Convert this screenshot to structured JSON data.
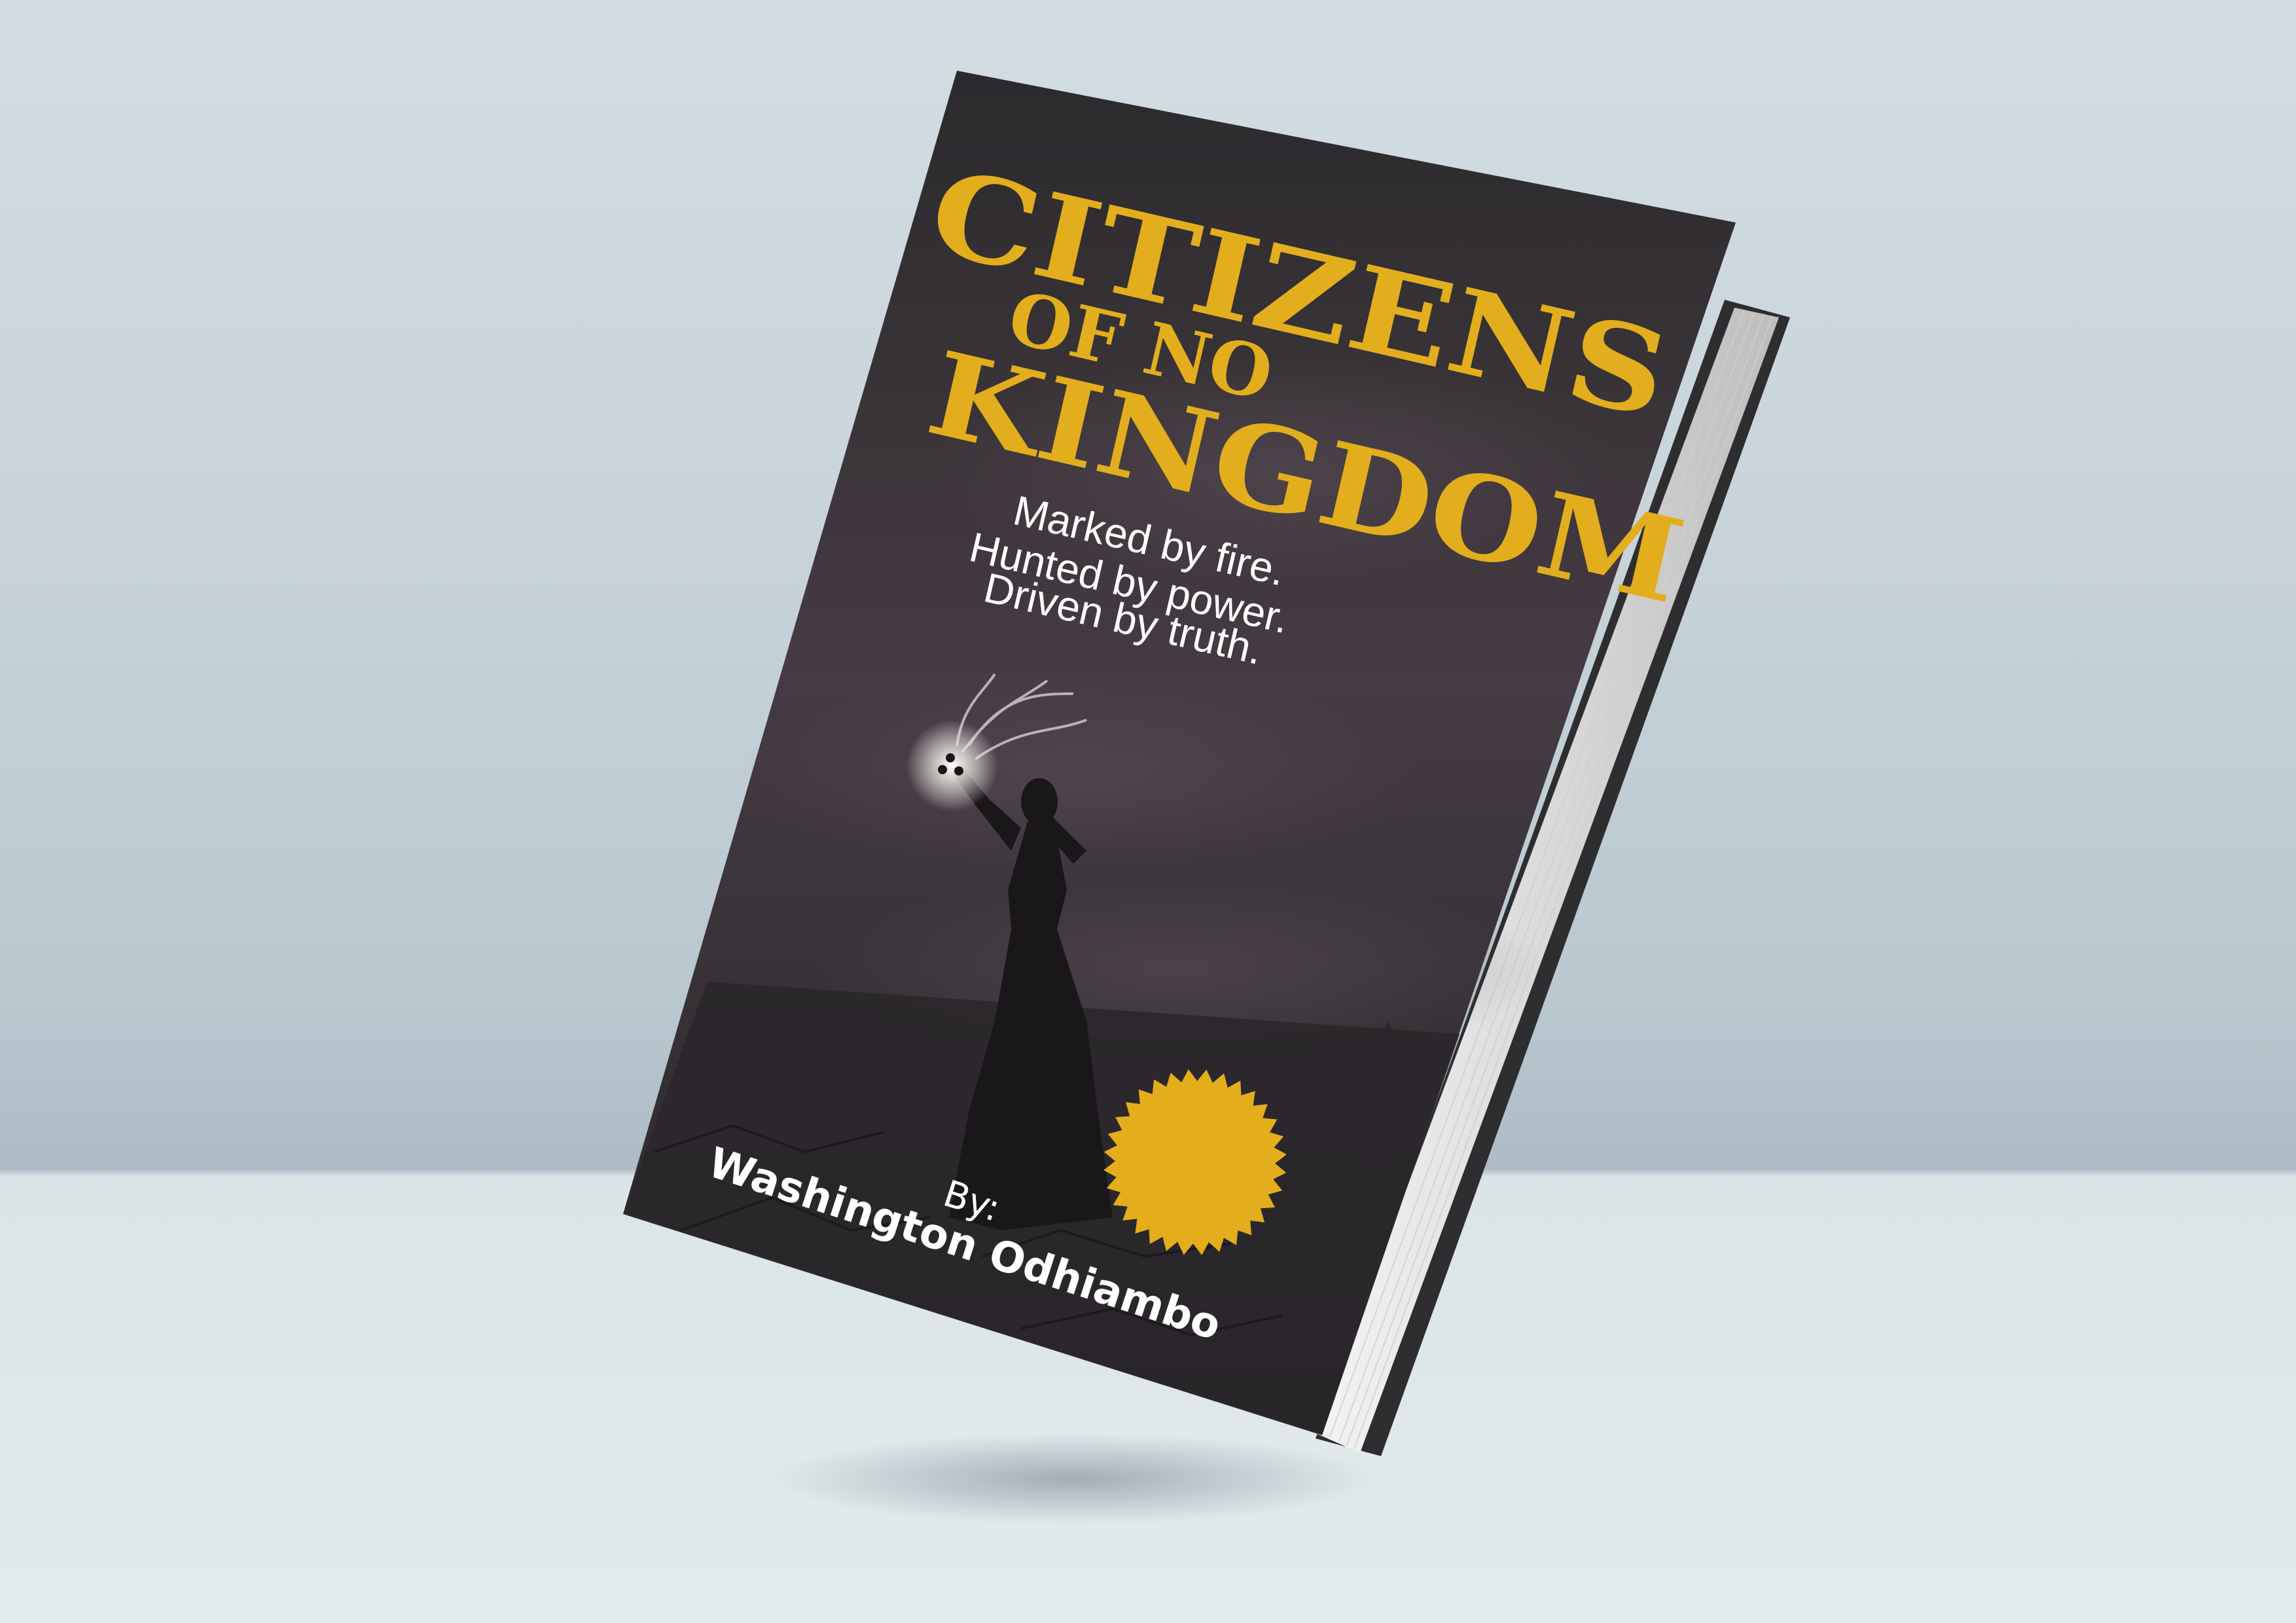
{
  "book": {
    "title_line1": "CITIZENS",
    "title_line2": "OF NO",
    "title_line3": "KINGDOM",
    "tagline": [
      "Marked by fire.",
      "Hunted by power.",
      "Driven by truth."
    ],
    "author_prefix": "By:",
    "author_name": "Washington Odhiambo"
  },
  "colors": {
    "title": "#e2ae1d",
    "badge": "#e3ad1b",
    "cover_dark": "#2c2a2e",
    "tagline": "#ffffff",
    "author": "#ffffff",
    "background_top": "#d3dde2",
    "floor": "#e1e8eb"
  }
}
